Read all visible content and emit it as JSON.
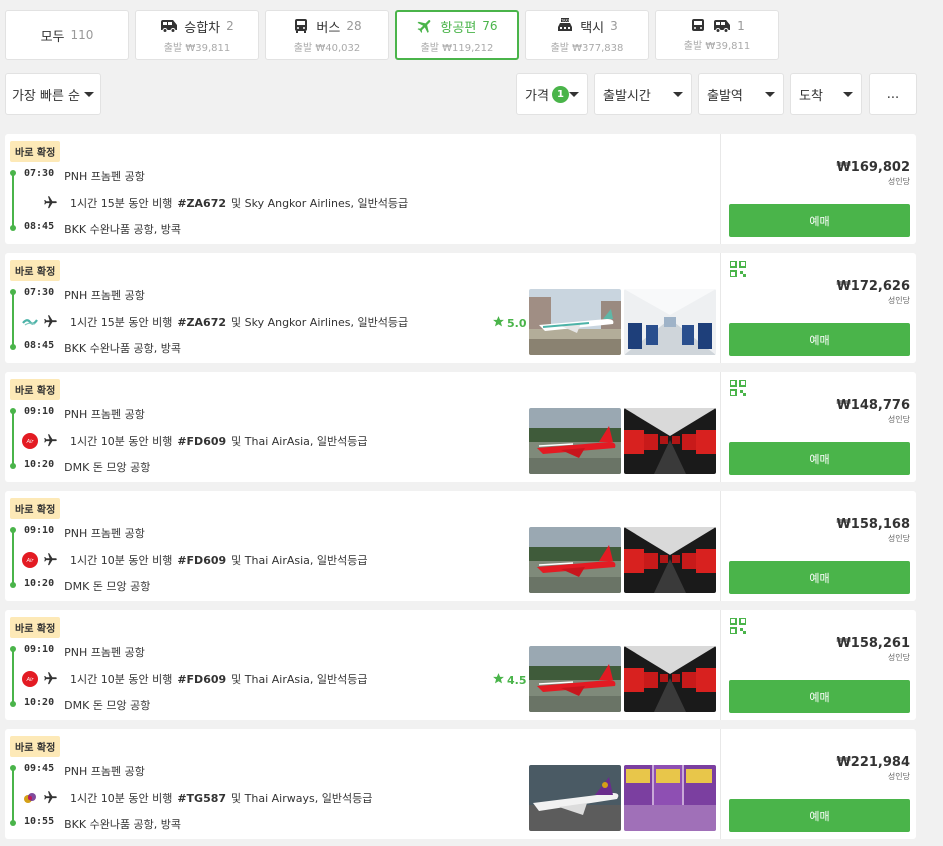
{
  "tabs": [
    {
      "key": "all",
      "label": "모두",
      "count": "110",
      "sub": ""
    },
    {
      "key": "van",
      "label": "승합차",
      "count": "2",
      "sub": "출발 ₩39,811"
    },
    {
      "key": "bus",
      "label": "버스",
      "count": "28",
      "sub": "출발 ₩40,032"
    },
    {
      "key": "flight",
      "label": "항공편",
      "count": "76",
      "sub": "출발 ₩119,212"
    },
    {
      "key": "taxi",
      "label": "택시",
      "count": "3",
      "sub": "출발 ₩377,838"
    },
    {
      "key": "busvan",
      "label": "",
      "count": "1",
      "sub": "출발 ₩39,811"
    }
  ],
  "sort": {
    "label": "가장 빠른 순"
  },
  "filters": {
    "price": "가격",
    "price_badge": "1",
    "departure_time": "출발시간",
    "departure_station": "출발역",
    "arrival": "도착",
    "more": "..."
  },
  "colors": {
    "accent": "#4ab44a",
    "confirm_bg": "#fde9b7",
    "airasia_red": "#e31b23"
  },
  "cards": [
    {
      "confirm": "바로 확정",
      "dep_time": "07:30",
      "dep_place": "PNH 프놈펜 공항",
      "duration": "1시간 15분 동안 비행",
      "flight_no": "#ZA672",
      "carrier": "및 Sky Angkor Airlines, 일반석등급",
      "arr_time": "08:45",
      "arr_place": "BKK 수완나품 공항, 방콕",
      "rating": "",
      "price": "₩169,802",
      "per": "성인당",
      "book": "예매",
      "logo": "none",
      "qr": false,
      "photos": false
    },
    {
      "confirm": "바로 확정",
      "dep_time": "07:30",
      "dep_place": "PNH 프놈펜 공항",
      "duration": "1시간 15분 동안 비행",
      "flight_no": "#ZA672",
      "carrier": "및 Sky Angkor Airlines, 일반석등급",
      "arr_time": "08:45",
      "arr_place": "BKK 수완나품 공항, 방콕",
      "rating": "5.0",
      "price": "₩172,626",
      "per": "성인당",
      "book": "예매",
      "logo": "skyangkor",
      "qr": true,
      "photos": "skyangkor"
    },
    {
      "confirm": "바로 확정",
      "dep_time": "09:10",
      "dep_place": "PNH 프놈펜 공항",
      "duration": "1시간 10분 동안 비행",
      "flight_no": "#FD609",
      "carrier": "및 Thai AirAsia, 일반석등급",
      "arr_time": "10:20",
      "arr_place": "DMK 돈 므앙 공항",
      "rating": "",
      "price": "₩148,776",
      "per": "성인당",
      "book": "예매",
      "logo": "airasia",
      "qr": true,
      "photos": "airasia"
    },
    {
      "confirm": "바로 확정",
      "dep_time": "09:10",
      "dep_place": "PNH 프놈펜 공항",
      "duration": "1시간 10분 동안 비행",
      "flight_no": "#FD609",
      "carrier": "및 Thai AirAsia, 일반석등급",
      "arr_time": "10:20",
      "arr_place": "DMK 돈 므앙 공항",
      "rating": "",
      "price": "₩158,168",
      "per": "성인당",
      "book": "예매",
      "logo": "airasia",
      "qr": false,
      "photos": "airasia"
    },
    {
      "confirm": "바로 확정",
      "dep_time": "09:10",
      "dep_place": "PNH 프놈펜 공항",
      "duration": "1시간 10분 동안 비행",
      "flight_no": "#FD609",
      "carrier": "및 Thai AirAsia, 일반석등급",
      "arr_time": "10:20",
      "arr_place": "DMK 돈 므앙 공항",
      "rating": "4.5",
      "price": "₩158,261",
      "per": "성인당",
      "book": "예매",
      "logo": "airasia",
      "qr": true,
      "photos": "airasia"
    },
    {
      "confirm": "바로 확정",
      "dep_time": "09:45",
      "dep_place": "PNH 프놈펜 공항",
      "duration": "1시간 10분 동안 비행",
      "flight_no": "#TG587",
      "carrier": "및 Thai Airways, 일반석등급",
      "arr_time": "10:55",
      "arr_place": "BKK 수완나품 공항, 방콕",
      "rating": "",
      "price": "₩221,984",
      "per": "성인당",
      "book": "예매",
      "logo": "thai",
      "qr": false,
      "photos": "thai"
    }
  ]
}
